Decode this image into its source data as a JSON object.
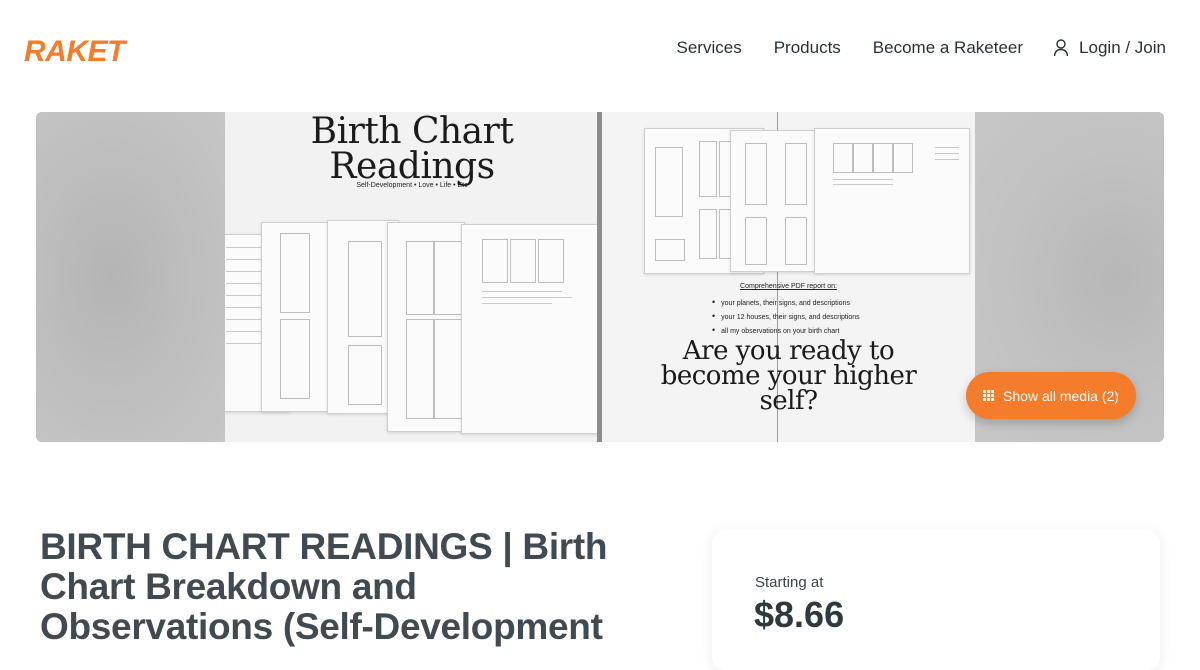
{
  "brand": {
    "name": "RAKET",
    "color": "#f47c2a"
  },
  "nav": {
    "services": "Services",
    "products": "Products",
    "become": "Become a Raketeer",
    "login": "Login / Join"
  },
  "gallery": {
    "left_image": {
      "title_line1": "Birth Chart",
      "title_line2": "Readings",
      "tagline": "Self-Development • Love • Life • Etc"
    },
    "right_image": {
      "report_title": "Comprehensive PDF report on:",
      "bullets": [
        "your planets, their signs, and descriptions",
        "your 12 houses, their signs, and descriptions",
        "all my observations on your birth chart"
      ],
      "headline_line1": "Are you ready to",
      "headline_line2": "become your higher",
      "headline_line3": "self?"
    },
    "show_media_label": "Show all media (2)"
  },
  "listing": {
    "title": "BIRTH CHART READINGS | Birth Chart Breakdown and Observations (Self-Development"
  },
  "pricing": {
    "label": "Starting at",
    "value": "$8.66"
  },
  "colors": {
    "accent": "#f47c2a",
    "title_text": "#404a50"
  }
}
